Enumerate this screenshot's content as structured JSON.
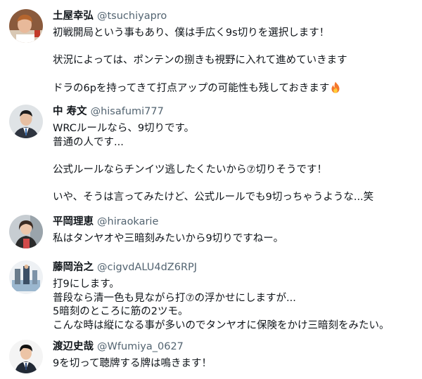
{
  "tweets": [
    {
      "name": "土屋幸弘",
      "handle": "@tsuchiyapro",
      "lines": [
        "初戦開局という事もあり、僕は手広く9s切りを選択します！",
        "",
        "状況によっては、ポンテンの捌きも視野に入れて進めていきます",
        "",
        "ドラの6pを持ってきて打点アップの可能性も残しておきます"
      ],
      "trailing_icon": "fire-emoji-icon"
    },
    {
      "name": "中 寿文",
      "handle": "@hisafumi777",
      "lines": [
        "WRCルールなら、9切りです。",
        "普通の人です...",
        "",
        "公式ルールならチンイツ逃したくたいから⑦切りそうです！",
        "",
        "いや、そうは言ってみたけど、公式ルールでも9切っちゃうような...笑"
      ]
    },
    {
      "name": "平岡理恵",
      "handle": "@hiraokarie",
      "lines": [
        "私はタンヤオや三暗刻みたいから9切りですねー。"
      ]
    },
    {
      "name": "藤岡治之",
      "handle": "@cigvdALU4dZ6RPJ",
      "lines": [
        "打9にします。",
        "普段なら清一色も見ながら打⑦の浮かせにしますが...",
        "5暗刻のところに筋の2ツモ。",
        "こんな時は縦になる事が多いのでタンヤオに保険をかけ三暗刻をみたい。"
      ]
    },
    {
      "name": "渡辺史哉",
      "handle": "@Wfumiya_0627",
      "lines": [
        "9を切って聴牌する牌は鳴きます！"
      ]
    }
  ]
}
